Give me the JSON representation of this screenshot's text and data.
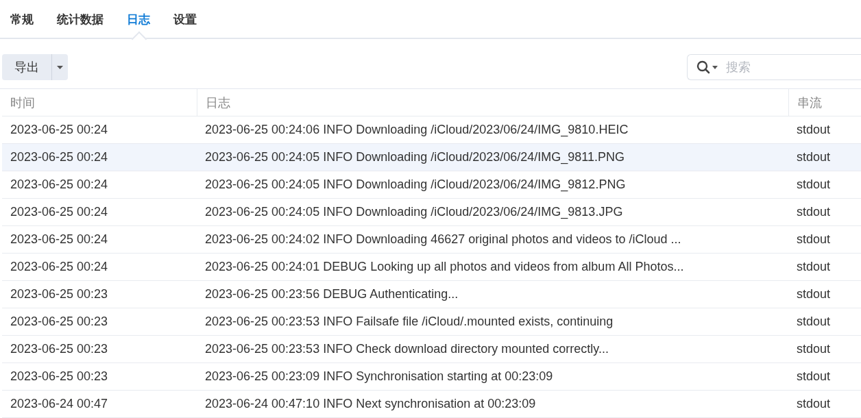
{
  "tabs": [
    {
      "label": "常规",
      "selected": false
    },
    {
      "label": "统计数据",
      "selected": false
    },
    {
      "label": "日志",
      "selected": true
    },
    {
      "label": "设置",
      "selected": false
    }
  ],
  "toolbar": {
    "export_button": "导出"
  },
  "search": {
    "placeholder": "搜索"
  },
  "table": {
    "columns": [
      "时间",
      "日志",
      "串流"
    ],
    "rows": [
      {
        "time": "2023-06-25 00:24",
        "log": "2023-06-25 00:24:06 INFO Downloading /iCloud/2023/06/24/IMG_9810.HEIC",
        "stream": "stdout",
        "selected": false
      },
      {
        "time": "2023-06-25 00:24",
        "log": "2023-06-25 00:24:05 INFO Downloading /iCloud/2023/06/24/IMG_9811.PNG",
        "stream": "stdout",
        "selected": true
      },
      {
        "time": "2023-06-25 00:24",
        "log": "2023-06-25 00:24:05 INFO Downloading /iCloud/2023/06/24/IMG_9812.PNG",
        "stream": "stdout",
        "selected": false
      },
      {
        "time": "2023-06-25 00:24",
        "log": "2023-06-25 00:24:05 INFO Downloading /iCloud/2023/06/24/IMG_9813.JPG",
        "stream": "stdout",
        "selected": false
      },
      {
        "time": "2023-06-25 00:24",
        "log": "2023-06-25 00:24:02 INFO Downloading 46627 original photos and videos to /iCloud ...",
        "stream": "stdout",
        "selected": false
      },
      {
        "time": "2023-06-25 00:24",
        "log": "2023-06-25 00:24:01 DEBUG Looking up all photos and videos from album All Photos...",
        "stream": "stdout",
        "selected": false
      },
      {
        "time": "2023-06-25 00:23",
        "log": "2023-06-25 00:23:56 DEBUG Authenticating...",
        "stream": "stdout",
        "selected": false
      },
      {
        "time": "2023-06-25 00:23",
        "log": "2023-06-25 00:23:53 INFO Failsafe file /iCloud/.mounted exists, continuing",
        "stream": "stdout",
        "selected": false
      },
      {
        "time": "2023-06-25 00:23",
        "log": "2023-06-25 00:23:53 INFO Check download directory mounted correctly...",
        "stream": "stdout",
        "selected": false
      },
      {
        "time": "2023-06-25 00:23",
        "log": "2023-06-25 00:23:09 INFO Synchronisation starting at 00:23:09",
        "stream": "stdout",
        "selected": false
      },
      {
        "time": "2023-06-24 00:47",
        "log": "2023-06-24 00:47:10 INFO Next synchronisation at 00:23:09",
        "stream": "stdout",
        "selected": false
      }
    ]
  }
}
